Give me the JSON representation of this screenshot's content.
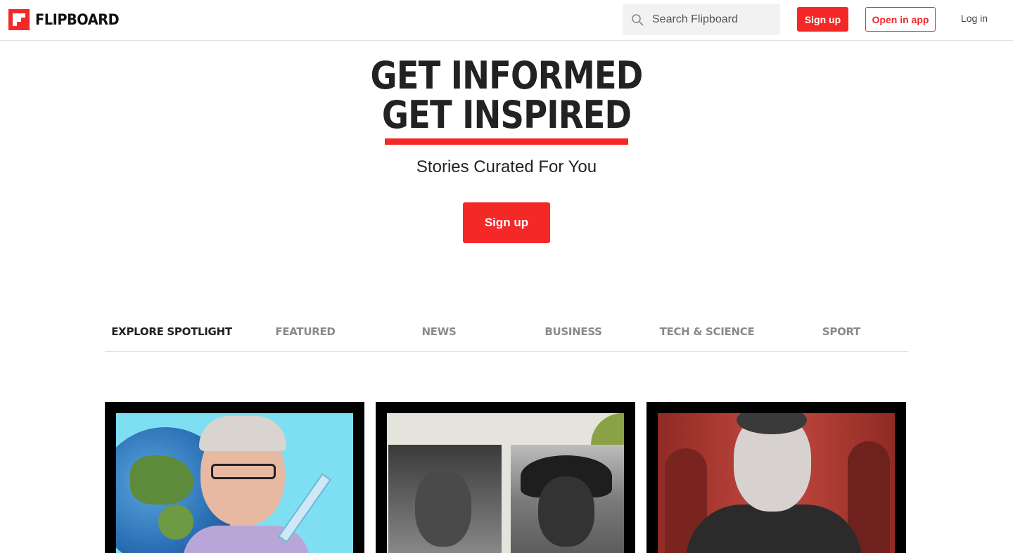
{
  "header": {
    "logo_text": "FLIPBOARD",
    "search_placeholder": "Search Flipboard",
    "signup_label": "Sign up",
    "open_app_label": "Open in app",
    "login_label": "Log in"
  },
  "hero": {
    "headline_line1": "GET INFORMED",
    "headline_line2": "GET INSPIRED",
    "subtitle": "Stories Curated For You",
    "signup_label": "Sign up"
  },
  "tabs": [
    {
      "label": "EXPLORE SPOTLIGHT",
      "active": true
    },
    {
      "label": "FEATURED",
      "active": false
    },
    {
      "label": "NEWS",
      "active": false
    },
    {
      "label": "BUSINESS",
      "active": false
    },
    {
      "label": "TECH & SCIENCE",
      "active": false
    },
    {
      "label": "SPORT",
      "active": false
    }
  ],
  "colors": {
    "brand_red": "#f52828",
    "text_dark": "#222222",
    "tab_inactive": "#8a8a8a"
  },
  "icons": {
    "logo": "flipboard-logo-icon",
    "search": "search-icon"
  }
}
